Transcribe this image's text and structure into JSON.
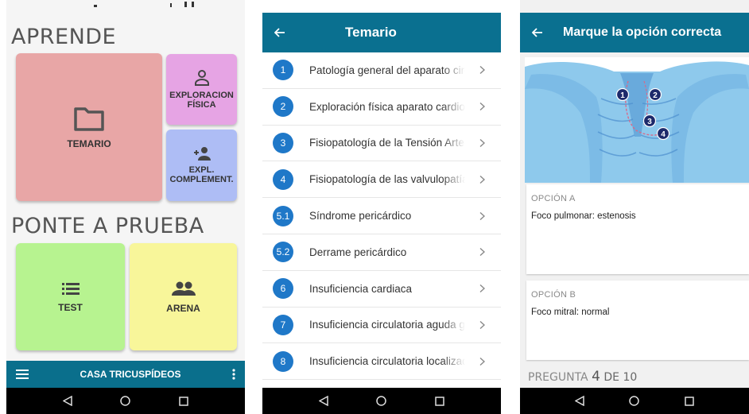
{
  "screen1": {
    "section_learn": "APRENDE",
    "tiles_learn": {
      "temario": "TEMARIO",
      "exploracion_l1": "EXPLORACION",
      "exploracion_l2": "FÍSICA",
      "expl_l1": "EXPL.",
      "expl_l2": "COMPLEMENT."
    },
    "section_test": "PONTE A PRUEBA",
    "tiles_test": {
      "test": "TEST",
      "arena": "ARENA"
    },
    "bottom_bar_title": "CASA TRICUSPÍDEOS",
    "colors": {
      "temario": "#e8a6a6",
      "exploracion": "#e6a4e4",
      "complement": "#aebdf5",
      "test": "#b7f390",
      "arena": "#f8f69a",
      "bar": "#0a6f8c"
    }
  },
  "screen2": {
    "title": "Temario",
    "items": [
      {
        "num": "1",
        "text": "Patología general del aparato circulatorio"
      },
      {
        "num": "2",
        "text": "Exploración física aparato cardiocirculatorio"
      },
      {
        "num": "3",
        "text": "Fisiopatología de la Tensión Arterial"
      },
      {
        "num": "4",
        "text": "Fisiopatología de las valvulopatías"
      },
      {
        "num": "5.1",
        "text": "Síndrome pericárdico"
      },
      {
        "num": "5.2",
        "text": "Derrame pericárdico"
      },
      {
        "num": "6",
        "text": "Insuficiencia cardiaca"
      },
      {
        "num": "7",
        "text": "Insuficiencia circulatoria aguda general"
      },
      {
        "num": "8",
        "text": "Insuficiencia circulatoria localizada"
      }
    ]
  },
  "screen3": {
    "title": "Marque la opción correcta",
    "markers": [
      "1",
      "2",
      "3",
      "4"
    ],
    "option_a_label": "OPCIÓN A",
    "option_a_text": "Foco pulmonar: estenosis",
    "option_b_label": "OPCIÓN B",
    "option_b_text": "Foco mitral: normal",
    "question_prefix": "PREGUNTA",
    "question_num": "4",
    "question_suffix": "DE 10"
  }
}
